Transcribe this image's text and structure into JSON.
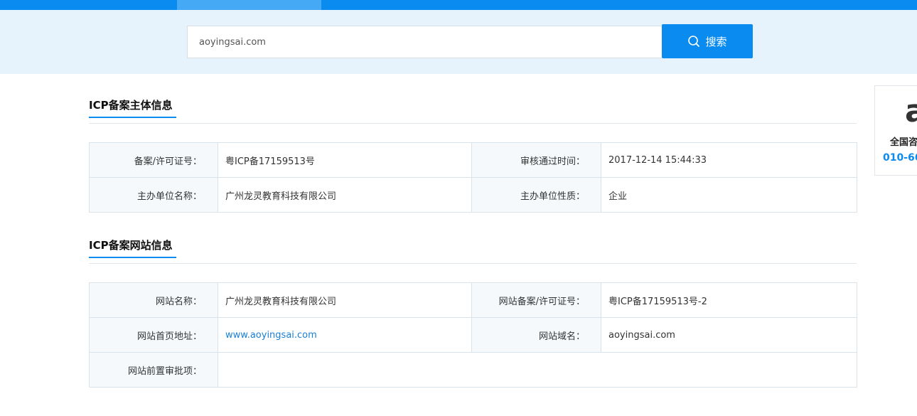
{
  "search": {
    "value": "aoyingsai.com",
    "button_label": "搜索"
  },
  "subject_section": {
    "title": "ICP备案主体信息",
    "rows": [
      [
        {
          "label": "备案/许可证号：",
          "value": "粤ICP备17159513号"
        },
        {
          "label": "审核通过时间：",
          "value": "2017-12-14 15:44:33"
        }
      ],
      [
        {
          "label": "主办单位名称：",
          "value": "广州龙灵教育科技有限公司"
        },
        {
          "label": "主办单位性质：",
          "value": "企业"
        }
      ]
    ]
  },
  "website_section": {
    "title": "ICP备案网站信息",
    "rows": [
      [
        {
          "label": "网站名称：",
          "value": "广州龙灵教育科技有限公司"
        },
        {
          "label": "网站备案/许可证号：",
          "value": "粤ICP备17159513号-2"
        }
      ],
      [
        {
          "label": "网站首页地址：",
          "value": "www.aoyingsai.com"
        },
        {
          "label": "网站域名：",
          "value": "aoyingsai.com"
        }
      ],
      [
        {
          "label": "网站前置审批项：",
          "value": ""
        }
      ]
    ]
  },
  "side_widget": {
    "glyph": "a",
    "hotline_label": "全国咨",
    "hotline_number": "010-66"
  },
  "colors": {
    "primary": "#0a8bf0",
    "band": "#e6f3fd",
    "label_bg": "#f5f9fc",
    "border": "#d9e3ec",
    "link": "#1a7fd4"
  }
}
